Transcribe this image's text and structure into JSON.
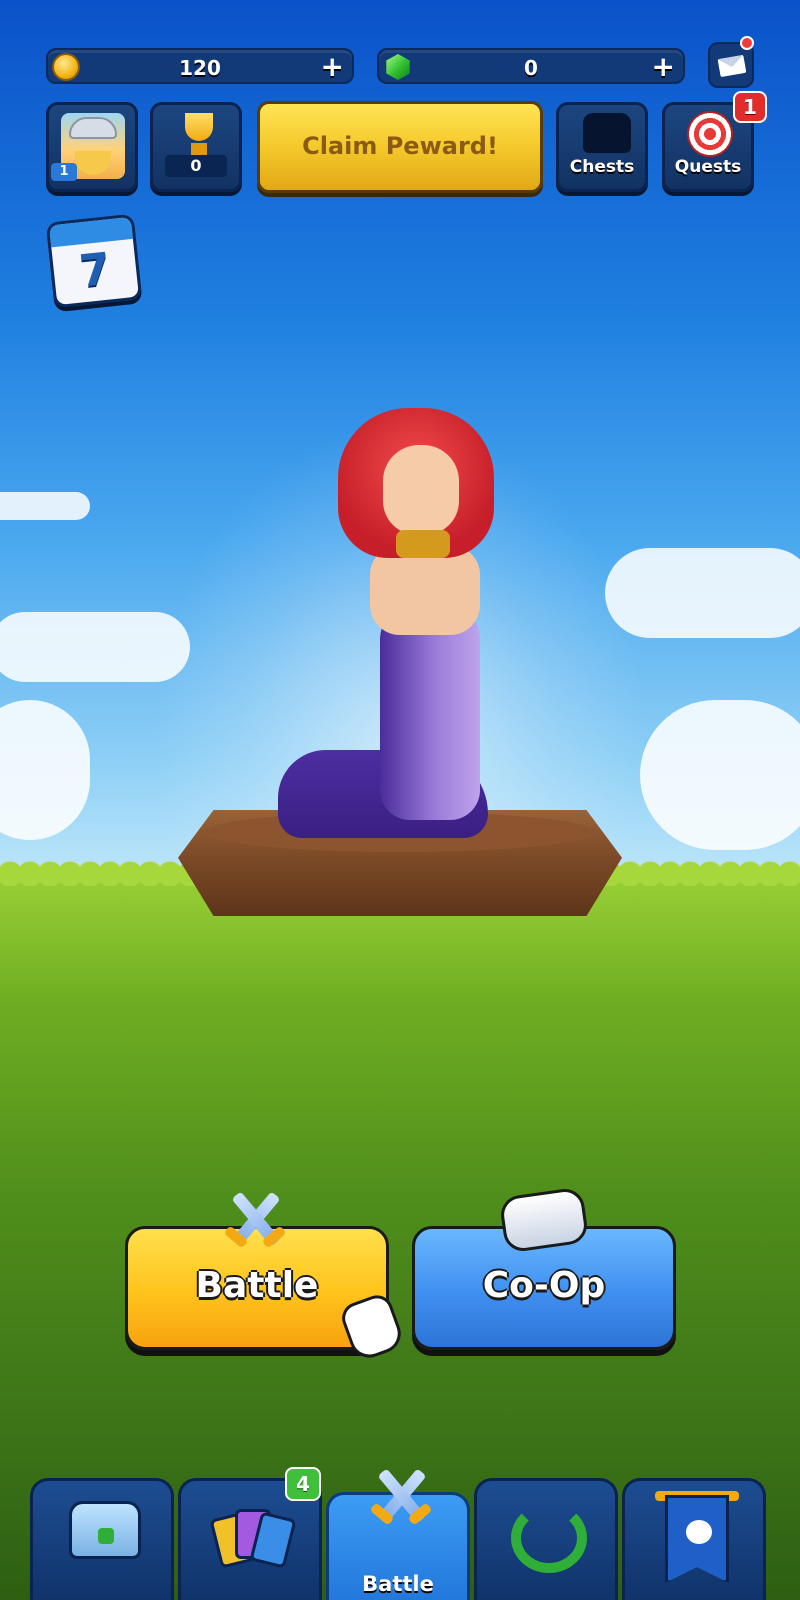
{
  "currencies": {
    "coins": {
      "value": "120",
      "icon": "coin-icon",
      "color": "#f3b316"
    },
    "gems": {
      "value": "0",
      "icon": "gem-icon",
      "color": "#2fbf2f"
    },
    "add_symbol": "+"
  },
  "mail": {
    "icon": "mail-icon",
    "has_notification": true
  },
  "profile": {
    "level": "1",
    "icon": "avatar-icon"
  },
  "trophies": {
    "count": "0",
    "icon": "trophy-icon"
  },
  "claim": {
    "label": "Claim Peward!"
  },
  "chests": {
    "label": "Chests",
    "icon": "chest-silhouette-icon"
  },
  "quests": {
    "label": "Quests",
    "badge": "1",
    "icon": "target-icon"
  },
  "calendar": {
    "day": "7",
    "icon": "calendar-icon"
  },
  "actions": {
    "battle": {
      "label": "Battle",
      "icon": "crossed-swords-icon"
    },
    "coop": {
      "label": "Co-Op",
      "icon": "handshake-icon"
    }
  },
  "nav": {
    "tabs": [
      {
        "id": "shop",
        "icon": "treasure-chest-icon",
        "label": ""
      },
      {
        "id": "cards",
        "icon": "cards-icon",
        "label": "",
        "badge": "4"
      },
      {
        "id": "battle",
        "icon": "crossed-swords-icon",
        "label": "Battle",
        "active": true
      },
      {
        "id": "leagues",
        "icon": "laurel-wreath-icon",
        "label": ""
      },
      {
        "id": "clan",
        "icon": "clan-banner-icon",
        "label": ""
      }
    ]
  },
  "colors": {
    "accent_yellow": "#ffc21a",
    "accent_blue": "#3f8ff0",
    "badge_red": "#e22b2b",
    "badge_green": "#3fbf3a"
  }
}
